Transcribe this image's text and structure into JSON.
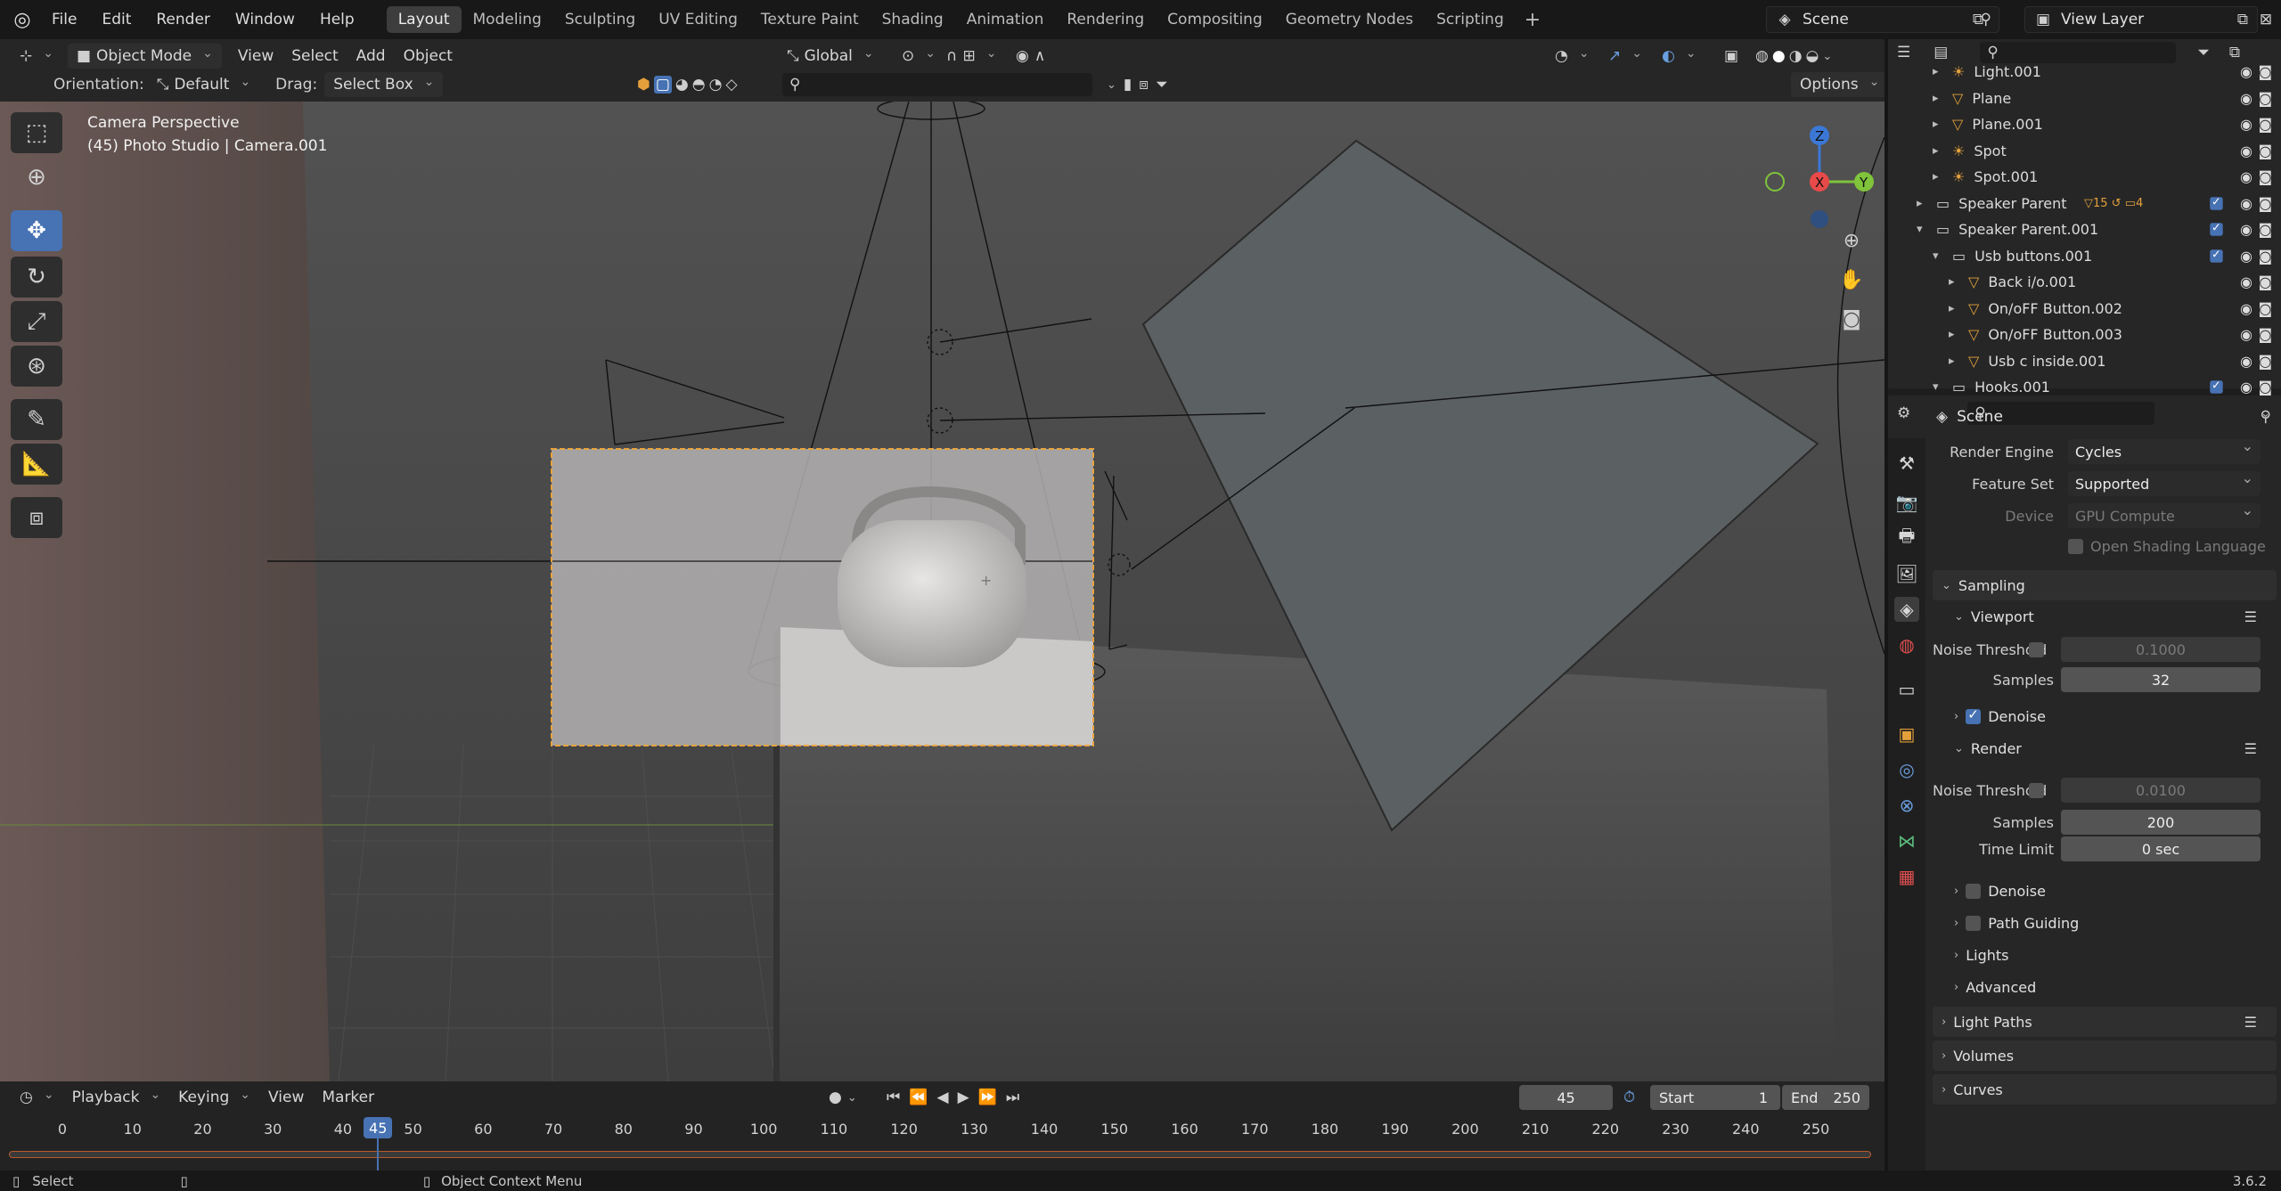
{
  "menu": {
    "items": [
      "File",
      "Edit",
      "Render",
      "Window",
      "Help"
    ]
  },
  "workspaces": [
    "Layout",
    "Modeling",
    "Sculpting",
    "UV Editing",
    "Texture Paint",
    "Shading",
    "Animation",
    "Rendering",
    "Compositing",
    "Geometry Nodes",
    "Scripting"
  ],
  "active_workspace": "Layout",
  "scene": {
    "name": "Scene"
  },
  "view_layer": {
    "name": "View Layer"
  },
  "header": {
    "mode": "Object Mode",
    "menus": [
      "View",
      "Select",
      "Add",
      "Object"
    ],
    "transform_orientation": "Global",
    "orientation_label": "Orientation:",
    "orientation_value": "Default",
    "drag_label": "Drag:",
    "drag_value": "Select Box",
    "options": "Options"
  },
  "viewport": {
    "line1": "Camera Perspective",
    "line2": "(45) Photo Studio | Camera.001"
  },
  "gizmo": {
    "z": "Z",
    "x": "X",
    "y": "Y"
  },
  "outliner": {
    "rows": [
      {
        "label": "Light.001",
        "indent": 2,
        "type": "light"
      },
      {
        "label": "Plane",
        "indent": 2,
        "type": "mesh"
      },
      {
        "label": "Plane.001",
        "indent": 2,
        "type": "mesh"
      },
      {
        "label": "Spot",
        "indent": 2,
        "type": "light"
      },
      {
        "label": "Spot.001",
        "indent": 2,
        "type": "light"
      },
      {
        "label": "Speaker Parent",
        "indent": 1,
        "type": "collection"
      },
      {
        "label": "Speaker Parent.001",
        "indent": 1,
        "type": "collection"
      },
      {
        "label": "Usb buttons.001",
        "indent": 2,
        "type": "collection"
      },
      {
        "label": "Back i/o.001",
        "indent": 3,
        "type": "mesh"
      },
      {
        "label": "On/oFF Button.002",
        "indent": 3,
        "type": "mesh"
      },
      {
        "label": "On/oFF Button.003",
        "indent": 3,
        "type": "mesh"
      },
      {
        "label": "Usb c inside.001",
        "indent": 3,
        "type": "mesh"
      },
      {
        "label": "Hooks.001",
        "indent": 2,
        "type": "collection"
      }
    ],
    "badge_15": "15",
    "badge_4": "4"
  },
  "properties": {
    "context": "Scene",
    "render_engine_label": "Render Engine",
    "render_engine": "Cycles",
    "feature_set_label": "Feature Set",
    "feature_set": "Supported",
    "device_label": "Device",
    "device": "GPU Compute",
    "osl": "Open Shading Language",
    "sampling": "Sampling",
    "viewport": "Viewport",
    "noise_threshold_label": "Noise Threshold",
    "viewport_noise_threshold": "0.1000",
    "samples_label": "Samples",
    "viewport_samples": "32",
    "denoise": "Denoise",
    "render": "Render",
    "render_noise_threshold": "0.0100",
    "render_samples": "200",
    "time_limit_label": "Time Limit",
    "time_limit": "0 sec",
    "path_guiding": "Path Guiding",
    "lights": "Lights",
    "advanced": "Advanced",
    "light_paths": "Light Paths",
    "volumes": "Volumes",
    "curves": "Curves"
  },
  "timeline": {
    "menus": [
      "Playback",
      "Keying",
      "View",
      "Marker"
    ],
    "current_frame": "45",
    "start_label": "Start",
    "start": "1",
    "end_label": "End",
    "end": "250",
    "ticks": [
      "0",
      "10",
      "20",
      "30",
      "40",
      "50",
      "60",
      "70",
      "80",
      "90",
      "100",
      "110",
      "120",
      "130",
      "140",
      "150",
      "160",
      "170",
      "180",
      "190",
      "200",
      "210",
      "220",
      "230",
      "240",
      "250"
    ],
    "playhead": "45"
  },
  "status": {
    "select": "Select",
    "context_menu": "Object Context Menu",
    "version": "3.6.2"
  },
  "colors": {
    "accent": "#4772b3",
    "camera_frame": "#e8a33c",
    "gizmo_x": "#e84a4a",
    "gizmo_y": "#7fc43b",
    "gizmo_z": "#3b78d6"
  }
}
